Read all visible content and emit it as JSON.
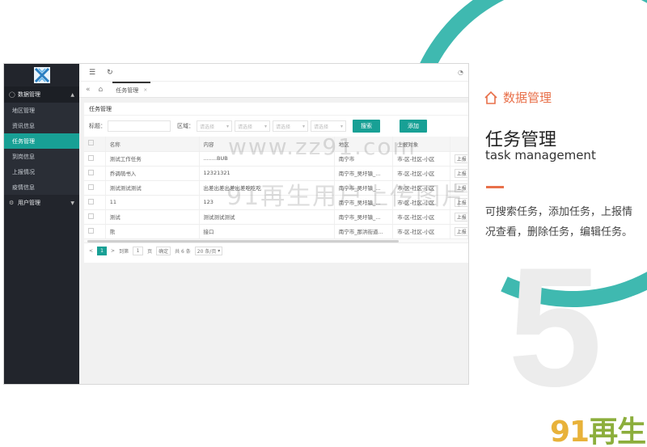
{
  "sidebar": {
    "groups": [
      {
        "label": "数据管理",
        "items": [
          "地区管理",
          "资讯信息",
          "任务管理",
          "到岗信息",
          "上报情况",
          "疫情信息"
        ]
      },
      {
        "label": "用户管理"
      }
    ],
    "active_item": "任务管理"
  },
  "topbar": {
    "menu_icon": "☰",
    "refresh_icon": "↻",
    "right_icon": "◔"
  },
  "tabbar": {
    "back_icon": "«",
    "home_icon": "⌂",
    "tab_label": "任务管理",
    "close": "×"
  },
  "card": {
    "title": "任务管理",
    "filters": {
      "title_label": "标题：",
      "area_label": "区域：",
      "select_placeholder": "请选择",
      "search_button": "搜索",
      "add_button": "添加"
    },
    "table": {
      "columns": [
        "名称",
        "内容",
        "地区",
        "上报对象"
      ],
      "rows": [
        {
          "name": "测试工作任务",
          "content": "........BUB",
          "area": "南宁市",
          "target": "市-区-社区-小区",
          "op": "上报"
        },
        {
          "name": "乔调萌书入",
          "content": "12321321",
          "area": "南宁市_吴圩镇_...",
          "target": "市-区-社区-小区",
          "op": "上报"
        },
        {
          "name": "测试测试测试",
          "content": "出差出差出差出差吃吃吃",
          "area": "南宁市_吴圩镇_...",
          "target": "市-区-社区-小区",
          "op": "上报"
        },
        {
          "name": "11",
          "content": "123",
          "area": "南宁市_吴圩镇_...",
          "target": "市-区-社区-小区",
          "op": "上报"
        },
        {
          "name": "测试",
          "content": "测试测试测试",
          "area": "南宁市_吴圩镇_...",
          "target": "市-区-社区-小区",
          "op": "上报"
        },
        {
          "name": "熊",
          "content": "接口",
          "area": "南宁市_那洪街道...",
          "target": "市-区-社区-小区",
          "op": "上报"
        }
      ]
    },
    "pager": {
      "prev": "<",
      "current": "1",
      "next": ">",
      "goto_label": "到第",
      "page_input": "1",
      "page_unit": "页",
      "confirm": "确定",
      "total": "共 6 条",
      "page_size": "20 条/页"
    }
  },
  "right_panel": {
    "section": "数据管理",
    "heading_cn": "任务管理",
    "heading_en": "task management",
    "description": "可搜索任务，添加任务，上报情况查看，删除任务，编辑任务。",
    "big_number": "5"
  },
  "watermark": {
    "line1": "www.zz91.com",
    "line2": "91再生用户上传图片"
  },
  "brand": {
    "num": "91",
    "text": "再生"
  },
  "colors": {
    "teal": "#18a095",
    "ring": "#3fb9b0",
    "accent": "#e8704a",
    "sidebar": "#22252c"
  }
}
